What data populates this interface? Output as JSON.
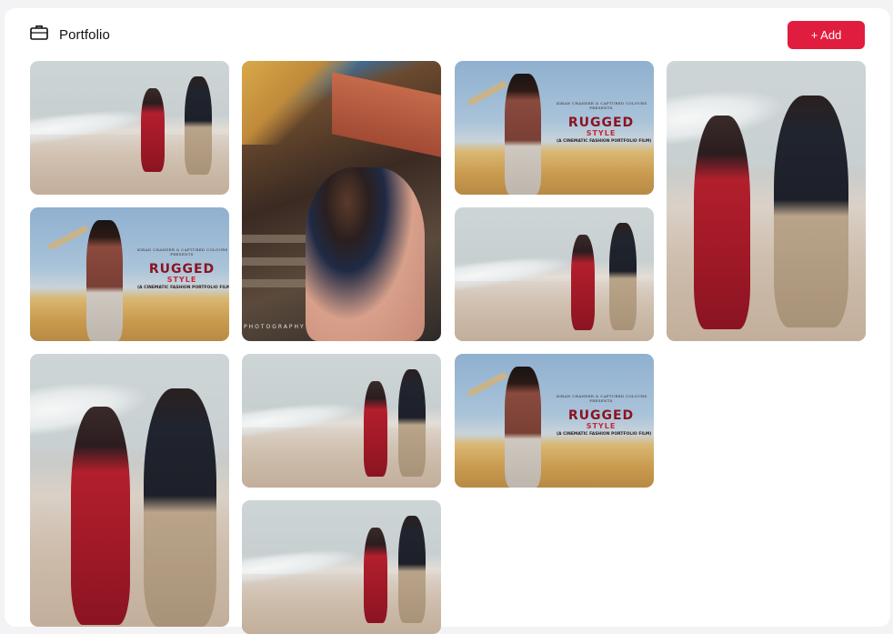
{
  "header": {
    "title": "Portfolio",
    "icon": "briefcase-icon",
    "add_label": "+ Add"
  },
  "colors": {
    "accent": "#e11d3f",
    "background": "#f3f3f5",
    "card": "#ffffff"
  },
  "rugged_poster": {
    "credit_line_1": "KIRAN CHANDER & CAPTURED COLOURS",
    "credit_line_2": "PRESENTS",
    "title": "RUGGED",
    "subtitle": "STYLE",
    "tagline": "(A CINEMATIC FASHION PORTFOLIO FILM)"
  },
  "hut_watermark": "PHOTOGRAPHY",
  "gallery": {
    "items": [
      {
        "scene": "beach-couple-running"
      },
      {
        "scene": "rugged-style-poster"
      },
      {
        "scene": "beach-couple-running"
      },
      {
        "scene": "couple-embrace-hut"
      },
      {
        "scene": "beach-couple-running"
      },
      {
        "scene": "rugged-style-poster"
      },
      {
        "scene": "beach-couple-running"
      },
      {
        "scene": "rugged-style-poster"
      },
      {
        "scene": "beach-couple-running-closeup"
      },
      {
        "scene": "beach-couple-running-closeup"
      }
    ]
  }
}
